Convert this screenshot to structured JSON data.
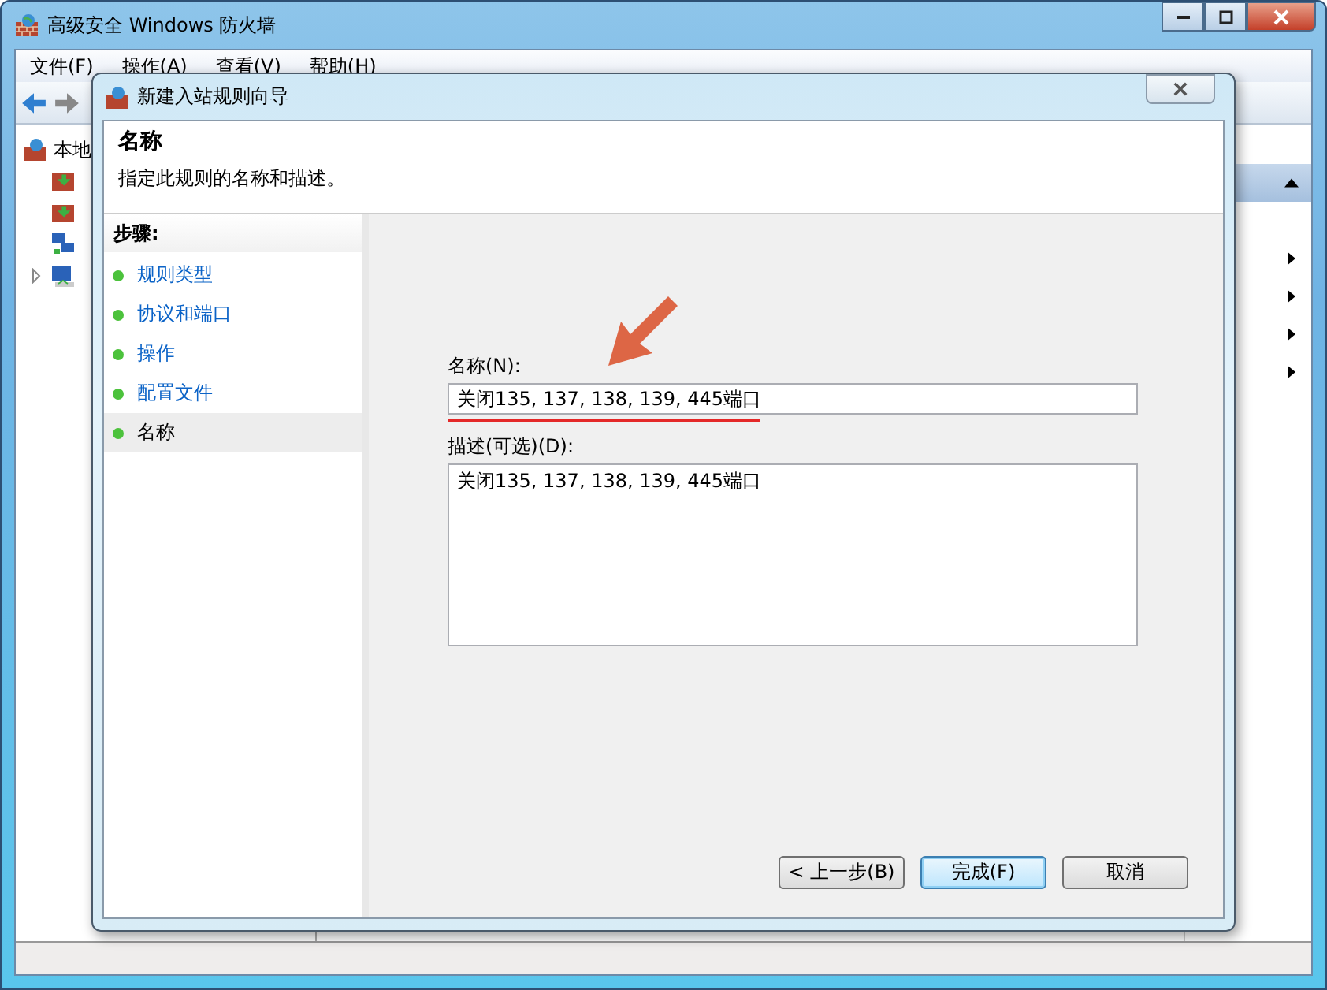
{
  "main_window": {
    "title": "高级安全 Windows 防火墙",
    "menu": [
      "文件(F)",
      "操作(A)",
      "查看(V)",
      "帮助(H)"
    ],
    "tree_root": "本地"
  },
  "dialog": {
    "title": "新建入站规则向导",
    "heading": "名称",
    "subheading": "指定此规则的名称和描述。",
    "steps_title": "步骤:",
    "steps": [
      {
        "label": "规则类型",
        "selected": false
      },
      {
        "label": "协议和端口",
        "selected": false
      },
      {
        "label": "操作",
        "selected": false
      },
      {
        "label": "配置文件",
        "selected": false
      },
      {
        "label": "名称",
        "selected": true
      }
    ],
    "name_field": {
      "label": "名称(N):",
      "value": "关闭135, 137, 138, 139, 445端口"
    },
    "description_field": {
      "label": "描述(可选)(D):",
      "value": "关闭135, 137, 138, 139, 445端口"
    },
    "buttons": [
      {
        "label": "< 上一步(B)",
        "default": false
      },
      {
        "label": "完成(F)",
        "default": true
      },
      {
        "label": "取消",
        "default": false
      }
    ]
  }
}
